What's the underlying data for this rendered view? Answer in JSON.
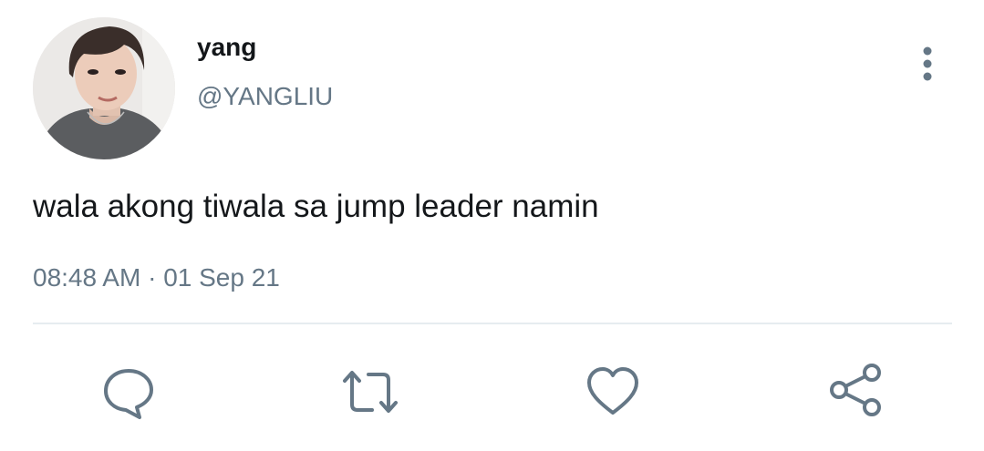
{
  "user": {
    "display_name": "yang",
    "handle": "@YANGLIU",
    "avatar_icon": "profile-photo"
  },
  "tweet": {
    "text": "wala akong tiwala sa jump leader namin",
    "time": "08:48 AM",
    "separator": "·",
    "date": "01 Sep 21"
  },
  "actions": {
    "reply_icon": "speech-bubble-icon",
    "retweet_icon": "retweet-icon",
    "like_icon": "heart-icon",
    "share_icon": "share-icon",
    "more_icon": "vertical-ellipsis-icon"
  },
  "colors": {
    "text_primary": "#14171a",
    "text_secondary": "#657786",
    "divider": "#e6ecf0",
    "icon": "#657786"
  }
}
